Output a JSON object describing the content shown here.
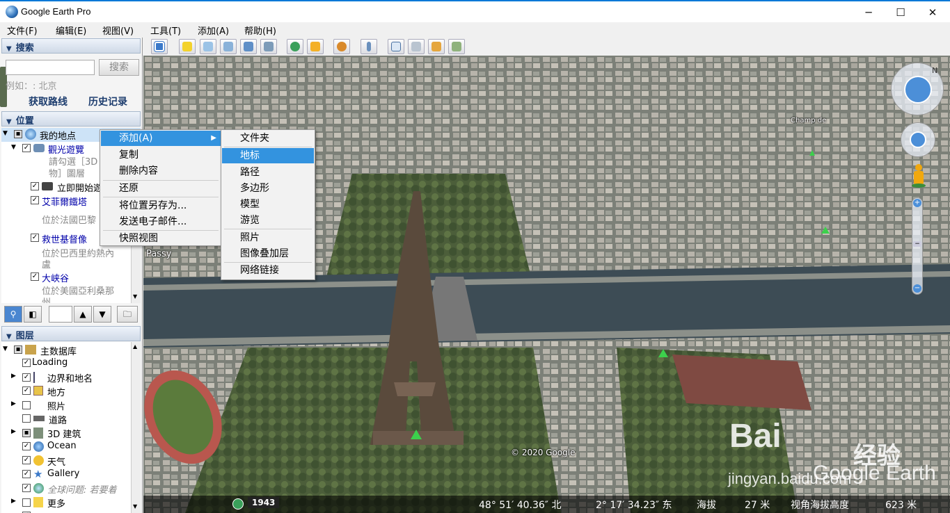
{
  "window": {
    "title": "Google Earth Pro",
    "minimize": "─",
    "maximize": "☐",
    "close": "✕"
  },
  "menu": [
    "文件(F)",
    "编辑(E)",
    "视图(V)",
    "工具(T)",
    "添加(A)",
    "帮助(H)"
  ],
  "search": {
    "header": "搜索",
    "button": "搜索",
    "hint": "例如：: 北京",
    "directions": "获取路线",
    "history": "历史记录"
  },
  "places": {
    "header": "位置",
    "items": [
      {
        "label": "我的地点"
      },
      {
        "label": "觀光遊覽"
      },
      {
        "label": "請勾選［3D"
      },
      {
        "label": "物］圖層"
      },
      {
        "label": "立即開始遊"
      },
      {
        "label": "艾菲爾鐵塔"
      },
      {
        "label": "位於法國巴黎"
      },
      {
        "label": "救世基督像"
      },
      {
        "label": "位於巴西里約熱內"
      },
      {
        "label": "盧"
      },
      {
        "label": "大峡谷"
      },
      {
        "label": "位於美國亞利桑那"
      },
      {
        "label": "州"
      }
    ]
  },
  "layers": {
    "header": "图层",
    "items": [
      {
        "label": "主数据库"
      },
      {
        "label": "Loading"
      },
      {
        "label": "边界和地名"
      },
      {
        "label": "地方"
      },
      {
        "label": "照片"
      },
      {
        "label": "道路"
      },
      {
        "label": "3D 建筑"
      },
      {
        "label": "Ocean"
      },
      {
        "label": "天气"
      },
      {
        "label": "Gallery"
      },
      {
        "label": "全球问题: 若要着"
      },
      {
        "label": "更多"
      },
      {
        "label": "地形"
      }
    ]
  },
  "context_menu": {
    "items": [
      "添加(A)",
      "复制",
      "删除内容",
      "还原",
      "将位置另存为...",
      "发送电子邮件...",
      "快照视图"
    ],
    "submenu": [
      "文件夹",
      "地标",
      "路径",
      "多边形",
      "模型",
      "游览",
      "照片",
      "图像叠加层",
      "网络链接"
    ]
  },
  "map": {
    "labels": {
      "passy": "Passy",
      "champ": "Champ de",
      "copyright": "© 2020 Google",
      "year": "1943"
    },
    "watermark": {
      "baidu": "Bai",
      "jingyan": "经验",
      "google_earth": "Google Earth",
      "url": "jingyan.baidu.com"
    }
  },
  "status": {
    "lat": "48° 51′ 40.36″ 北",
    "lon": "2° 17′ 34.23″ 东",
    "elev_label": "海拔",
    "elev": "27 米",
    "eye_label": "视角海拔高度",
    "eye": "623 米"
  },
  "colors": {
    "highlight": "#3393df",
    "accent": "#0078d7"
  }
}
